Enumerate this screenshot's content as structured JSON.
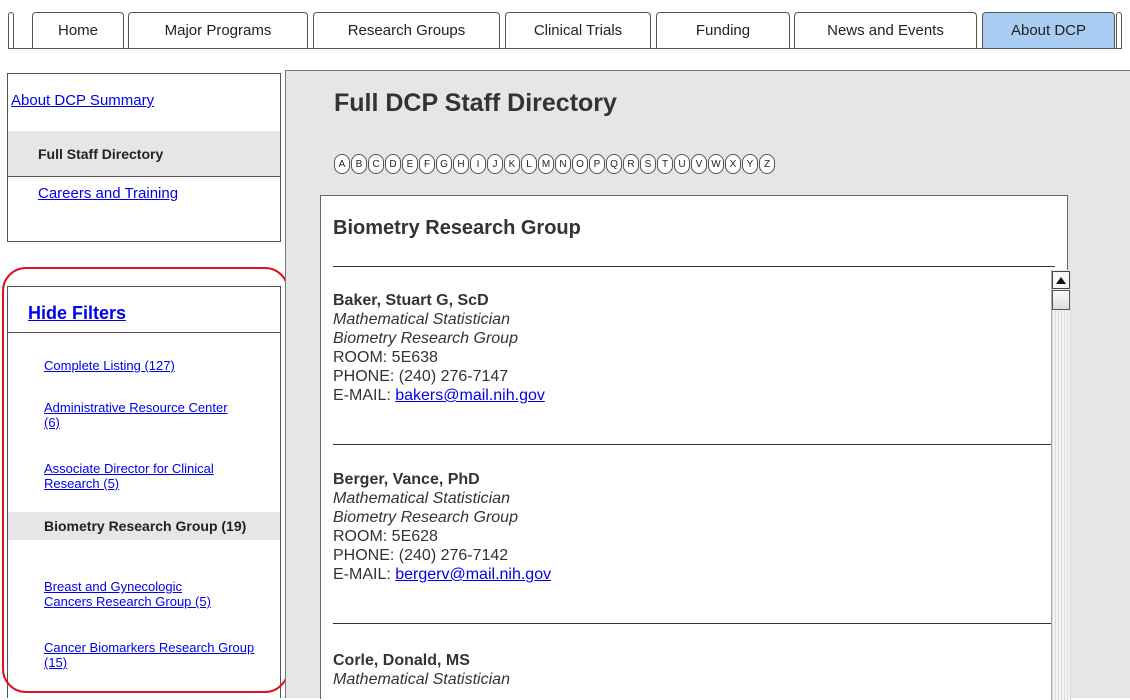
{
  "topnav": {
    "tabs": [
      {
        "label": "Home"
      },
      {
        "label": "Major Programs"
      },
      {
        "label": "Research Groups"
      },
      {
        "label": "Clinical Trials"
      },
      {
        "label": "Funding"
      },
      {
        "label": "News and Events"
      },
      {
        "label": "About DCP",
        "active": true
      }
    ]
  },
  "sidenav": {
    "summary_link": "About DCP Summary",
    "active_item": "Full Staff Directory",
    "careers_link": "Careers and Training"
  },
  "filters": {
    "toggle_label": "Hide Filters",
    "items": [
      {
        "label": "Complete Listing (127)"
      },
      {
        "label": "Administrative Resource Center (6)"
      },
      {
        "label": "Associate Director for Clinical Research (5)"
      },
      {
        "label": "Biometry Research Group (19)",
        "active": true
      },
      {
        "label": "Breast and Gynecologic Cancers Research Group (5)"
      },
      {
        "label": "Cancer Biomarkers Research Group (15)"
      }
    ]
  },
  "main": {
    "title": "Full DCP Staff Directory",
    "alphabet": [
      "A",
      "B",
      "C",
      "D",
      "E",
      "F",
      "G",
      "H",
      "I",
      "J",
      "K",
      "L",
      "M",
      "N",
      "O",
      "P",
      "Q",
      "R",
      "S",
      "T",
      "U",
      "V",
      "W",
      "X",
      "Y",
      "Z"
    ],
    "group_title": "Biometry Research Group",
    "staff": [
      {
        "name": "Baker, Stuart G, ScD",
        "title": "Mathematical Statistician",
        "group": "Biometry Research Group",
        "room": "ROOM: 5E638",
        "phone": "PHONE: (240) 276-7147",
        "email_label": "E-MAIL: ",
        "email": "bakers@mail.nih.gov"
      },
      {
        "name": "Berger, Vance, PhD",
        "title": "Mathematical Statistician",
        "group": "Biometry Research Group",
        "room": "ROOM: 5E628",
        "phone": "PHONE: (240) 276-7142",
        "email_label": "E-MAIL: ",
        "email": "bergerv@mail.nih.gov"
      },
      {
        "name": "Corle, Donald, MS",
        "title": "Mathematical Statistician"
      }
    ]
  },
  "colors": {
    "active_tab": "#a9ccf2",
    "link": "#0000ee",
    "highlight": "#e6e6e6",
    "annotation_ring": "#e2101a"
  }
}
